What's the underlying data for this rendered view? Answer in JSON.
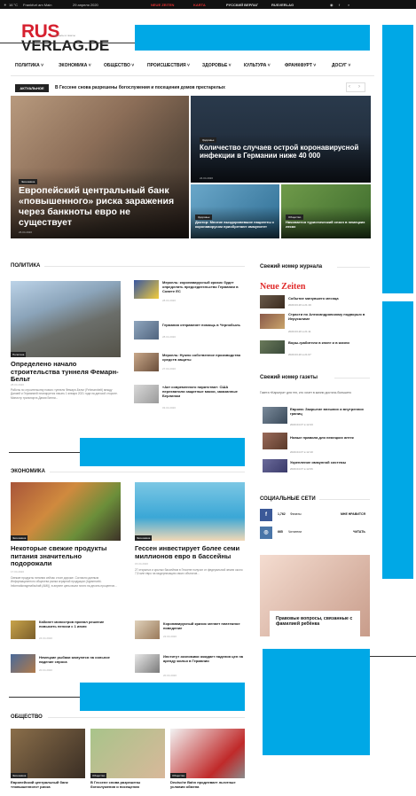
{
  "topbar": {
    "weather": "16 °C",
    "city": "Frankfurt am Main",
    "date": "29 апреля 2020",
    "promos": [
      "NEUE ZEITEN",
      "KARTA",
      "РУССКИЙ ВЕРЛАГ",
      "RUSVERLAG"
    ]
  },
  "header": {
    "logo_top": "RUS",
    "logo_bottom": "VERLAG.DE",
    "tagline": "журналы и газеты"
  },
  "nav": {
    "items": [
      "ПОЛИТИКА",
      "ЭКОНОМИКА",
      "ОБЩЕСТВО",
      "ПРОИСШЕСТВИЯ",
      "ЗДОРОВЬЕ",
      "КУЛЬТУРА",
      "ФРАНКФУРТ",
      "ДОСУГ"
    ]
  },
  "ticker": {
    "badge": "АКТУАЛЬНОЕ",
    "text": "В Гессене снова разрешены богослужения и посещения домов престарелых"
  },
  "hero": {
    "main": {
      "category": "Экономика",
      "title": "Европейский центральный банк «повышенного» риска заражения через банкноты евро не существует",
      "date": "26.04.2020"
    },
    "top_right": {
      "category": "Здоровье",
      "title": "Количество случаев острой коронавирусной инфекции в Германии ниже 40 000",
      "date": "24.04.2020"
    },
    "bottom_left": {
      "category": "Здоровье",
      "title": "Доктор: Многие выздоровевшие пациенты с коронавирусом приобретают иммунитет"
    },
    "bottom_right": {
      "category": "Общество",
      "title": "Начинается туристический сезон в немецких лесах"
    }
  },
  "politics": {
    "heading": "ПОЛИТИКА",
    "lead": {
      "category": "Политика",
      "title": "Определено начало строительства туннеля Фемарн-Бельт",
      "date": "28.04.2020",
      "excerpt": "Работы по строительству нового туннеля Фемарн-Бельт (Fehmarnbelt) между Данией и Германией планируется начать 1 января 2021 года на датской стороне. Министр транспорта Дании Бенни..."
    },
    "list": [
      {
        "title": "Меркель: коронавирусный кризис будет определять председательство Германии в Совете ЕС",
        "date": "28.04.2020"
      },
      {
        "title": "Германия отправляет помощь в Чернобыль",
        "date": "28.04.2020"
      },
      {
        "title": "Меркель: Нужно собственное производство средств защиты",
        "date": "27.04.2020"
      },
      {
        "title": "«Акт современного пиратства»: США перехватили защитные маски, заказанные Берлином",
        "date": "03.04.2020"
      }
    ]
  },
  "economy": {
    "heading": "ЭКОНОМИКА",
    "left": {
      "category": "Экономика",
      "title": "Некоторые свежие продукты питания значительно подорожали",
      "date": "17.04.2020",
      "excerpt": "Свежие продукты питания сейчас стоят дороже. Согласно данным Информационного общества рынка аграрной продукции (Agrarmarkt-Informationsgesellschaft (AMI)), в апреле цены выли почти на десять процентов..."
    },
    "right": {
      "category": "Экономика",
      "title": "Гессен инвестирует более семи миллионов евро в бассейны",
      "date": "15.04.2020",
      "excerpt": "27 открытых и крытых бассейнов в Гессене получат от федеральной земли около 7,5 млн евро на модернизацию своих объектов..."
    },
    "list": [
      {
        "title": "Кабинет министров принял решение повысить пенсии с 1 июля",
        "date": "24.04.2020"
      },
      {
        "title": "Коронавирусный кризис меняет платежное поведение",
        "date": "22.04.2020"
      },
      {
        "title": "Немецкие рыбаки жалуются на сильное падение спроса",
        "date": "20.04.2020"
      },
      {
        "title": "Институт экономики ожидает падения цен на аренду жилья в Германии",
        "date": "20.04.2020"
      }
    ]
  },
  "society": {
    "heading": "ОБЩЕСТВО",
    "items": [
      {
        "category": "Экономика",
        "title": "Европейский центральный банк «повышенного» риска"
      },
      {
        "category": "Общество",
        "title": "В Гессене снова разрешены богослужения и посещения"
      },
      {
        "category": "Общество",
        "title": "Deutsche Bahn продлевает льготные условия обмена"
      }
    ]
  },
  "sidebar": {
    "journal_heading": "Свежий номер журнала",
    "journal_logo": "Neue Zeiten",
    "journal_items": [
      {
        "title": "Событие минувшего месяца",
        "date": "2020.03.26 в 21:19"
      },
      {
        "title": "Страсти по Александровскому подворью в Иерусалиме",
        "date": "2020.03.26 в 21:11"
      },
      {
        "title": "Воры-грабители в книге и в жизни",
        "date": "2020.03.26 в 21:07"
      }
    ],
    "paper_heading": "Свежий номер газеты",
    "paper_broken": "Газета «Карьера» для тех, кто хочет в жизни достичь большего",
    "paper_items": [
      {
        "title": "Европа: Закрытие внешних и внутренних границ",
        "date": "2020.04.07 в 12:23"
      },
      {
        "title": "Новые правила для немецких аптек",
        "date": "2020.04.07 в 12:10"
      },
      {
        "title": "Укрепление иммунной системы",
        "date": "2020.04.07 в 12:06"
      }
    ],
    "social_heading": "СОЦИАЛЬНЫЕ СЕТИ",
    "social": [
      {
        "icon": "f",
        "count": "1,762",
        "label": "Фанаты",
        "action": "МНЕ НРАВИТСЯ",
        "color": "#3b5998"
      },
      {
        "icon": "◎",
        "count": "665",
        "label": "Читатели",
        "action": "ЧИТАТЬ",
        "color": "#4a76a8"
      }
    ],
    "card_title": "Правовые вопросы, связанные с фамилией ребёнка"
  },
  "colors": {
    "accent_red": "#d6202f",
    "ad_blue": "#00a8e6"
  }
}
